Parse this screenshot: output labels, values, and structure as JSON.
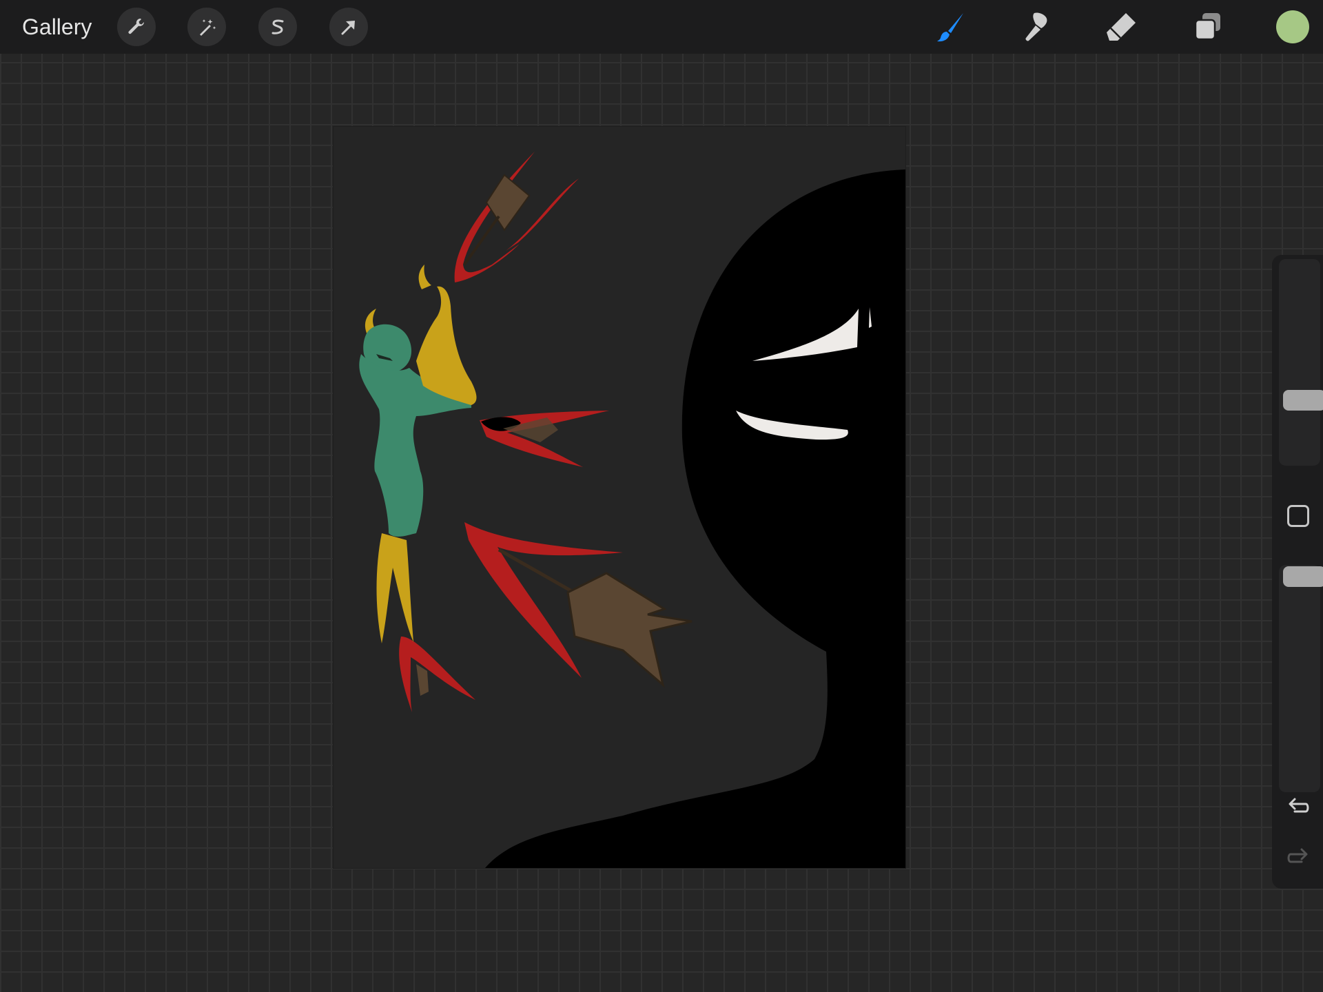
{
  "toolbar": {
    "gallery_label": "Gallery",
    "left_tools": [
      "wrench-icon",
      "magic-wand-icon",
      "selection-icon",
      "transform-arrow-icon"
    ],
    "right_tools": [
      "brush-icon",
      "smudge-icon",
      "eraser-icon",
      "layers-icon"
    ],
    "active_tool": "brush",
    "active_color": "#a6c885",
    "accent_color": "#1e8cff"
  },
  "sidebar": {
    "brush_size_level": 0.68,
    "opacity_level": 0.0,
    "buttons": [
      "modify-square-icon",
      "undo-icon",
      "redo-icon"
    ]
  },
  "canvas": {
    "background": "#252525",
    "figure_colors": {
      "silhouette": "#000000",
      "eyes": "#eeebe8",
      "skin": "#3d8a6c",
      "gold": "#c9a21a",
      "streak": "#b51e1e",
      "arrow_wood": "#5a4632"
    }
  }
}
